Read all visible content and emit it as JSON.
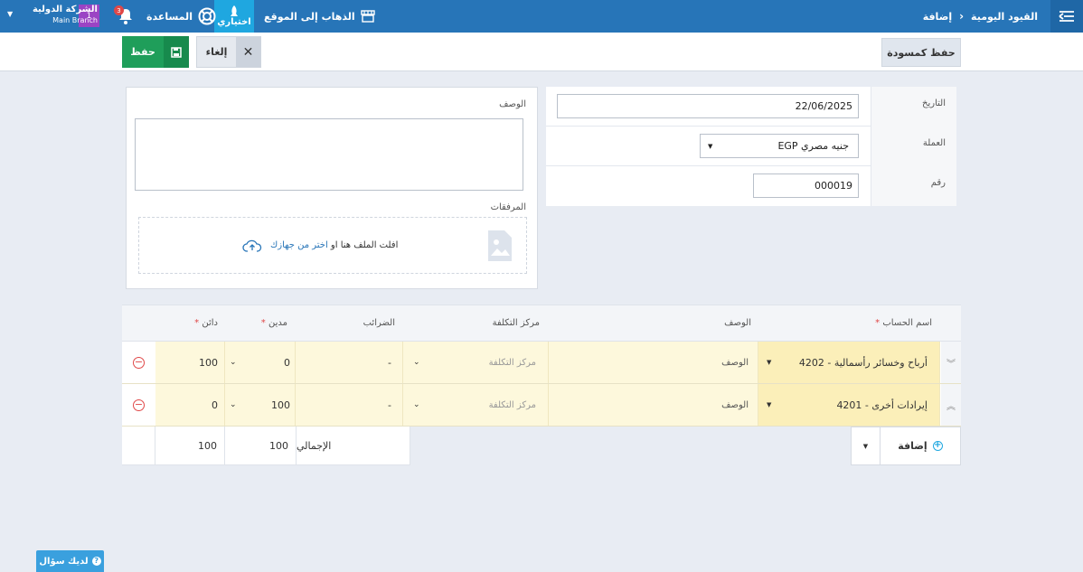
{
  "topbar": {
    "breadcrumb_parent": "القيود اليومية",
    "breadcrumb_current": "إضافة",
    "company_name": "الشركة الدولية",
    "branch_name": "Main Branch",
    "company_badge": "1",
    "notifications_count": "3",
    "help_label": "المساعدة",
    "optional_label": "اختياري",
    "go_to_site_label": "الذهاب إلى الموقع"
  },
  "actions": {
    "save_label": "حفظ",
    "cancel_label": "إلغاء",
    "save_draft_label": "حفظ كمسودة"
  },
  "form": {
    "date_label": "التاريخ",
    "date_value": "22/06/2025",
    "currency_label": "العملة",
    "currency_value": "EGP جنيه مصري",
    "number_label": "رقم",
    "number_value": "000019"
  },
  "description": {
    "title": "الوصف",
    "value": "",
    "attachments_title": "المرفقات",
    "drop_text": "افلت الملف هنا او",
    "choose_link": "اختر من جهازك"
  },
  "table": {
    "headers": {
      "account": "اسم الحساب",
      "description": "الوصف",
      "cost_center": "مركز التكلفة",
      "taxes": "الضرائب",
      "debit": "مدين",
      "credit": "دائن"
    },
    "rows": [
      {
        "account": "4202 - أرباح وخسائر رأسمالية",
        "description": "الوصف",
        "cost_center": "مركز التكلفة",
        "tax": "-",
        "debit": "0",
        "credit": "100"
      },
      {
        "account": "4201 - إيرادات أخرى",
        "description": "الوصف",
        "cost_center": "مركز التكلفة",
        "tax": "-",
        "debit": "100",
        "credit": "0"
      }
    ],
    "totals_label": "الإجمالي",
    "total_debit": "100",
    "total_credit": "100",
    "add_label": "إضافة"
  },
  "help_button_label": "لديك سؤال",
  "colors": {
    "topbar": "#2775b8",
    "optional_tab": "#1fa7e0",
    "save_button": "#1f9e5a",
    "company_badge": "#9b44c4",
    "row_highlight": "#fdf8dc",
    "required": "#e04848"
  }
}
